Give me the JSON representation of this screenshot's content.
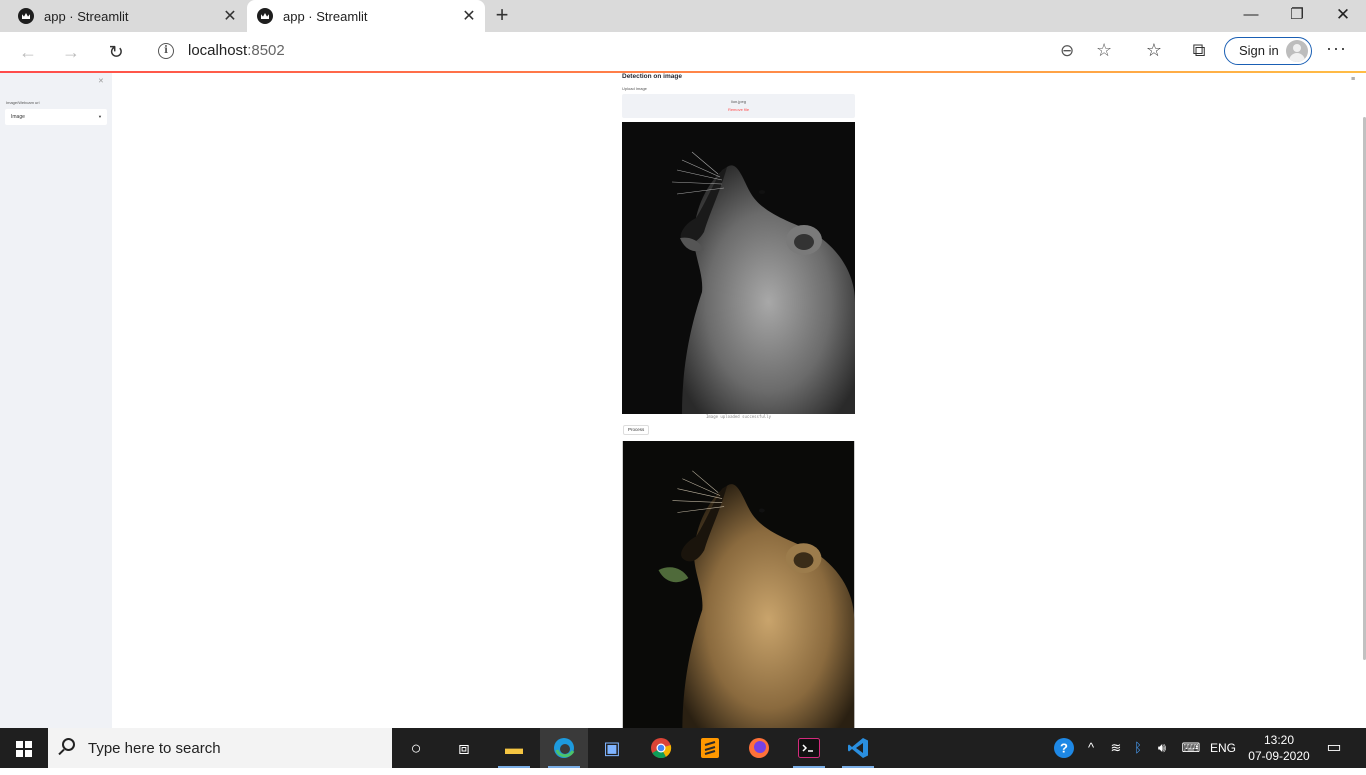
{
  "browser": {
    "tabs": [
      {
        "title": "app · Streamlit",
        "active": false
      },
      {
        "title": "app · Streamlit",
        "active": true
      }
    ],
    "new_tab_symbol": "+",
    "address": {
      "host": "localhost",
      "port": ":8502"
    },
    "sign_in_label": "Sign in",
    "icons": [
      "back-icon",
      "forward-icon",
      "refresh-icon",
      "info-icon",
      "zoom-icon",
      "favorite-star-icon",
      "favorites-icon",
      "collections-icon",
      "more-icon"
    ]
  },
  "sidebar": {
    "select_label": "Image/Webcam url",
    "select_value": "Image"
  },
  "main": {
    "title": "Detection on image",
    "upload_label": "Upload Image",
    "file_name": "lion.jpeg",
    "remove_label": "Remove file",
    "caption": "Image uploaded successfully",
    "process_label": "Process"
  },
  "taskbar": {
    "search_placeholder": "Type here to search",
    "apps": [
      "cortana-icon",
      "task-view-icon",
      "file-explorer-icon",
      "edge-icon",
      "store-icon",
      "chrome-icon",
      "sublime-icon",
      "firefox-icon",
      "terminal-icon",
      "vscode-icon"
    ],
    "language": "ENG",
    "time": "13:20",
    "date": "07-09-2020"
  },
  "colors": {
    "accent": "#ff4b4b",
    "sidebar_bg": "#f0f2f6",
    "taskbar_bg": "#1f1f1f"
  }
}
